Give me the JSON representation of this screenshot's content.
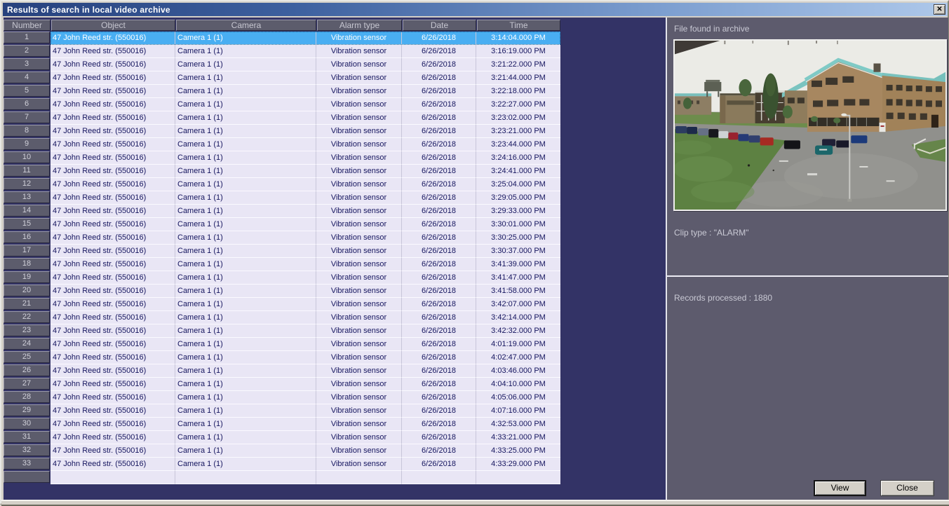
{
  "window": {
    "title": "Results of search in local video archive",
    "close_glyph": "✕"
  },
  "table": {
    "columns": [
      "Number",
      "Object",
      "Camera",
      "Alarm type",
      "Date",
      "Time"
    ],
    "object": "47 John Reed str. (550016)",
    "camera": "Camera 1 (1)",
    "alarm_type": "Vibration sensor",
    "date": "6/26/2018",
    "times": [
      "3:14:04.000 PM",
      "3:16:19.000 PM",
      "3:21:22.000 PM",
      "3:21:44.000 PM",
      "3:22:18.000 PM",
      "3:22:27.000 PM",
      "3:23:02.000 PM",
      "3:23:21.000 PM",
      "3:23:44.000 PM",
      "3:24:16.000 PM",
      "3:24:41.000 PM",
      "3:25:04.000 PM",
      "3:29:05.000 PM",
      "3:29:33.000 PM",
      "3:30:01.000 PM",
      "3:30:25.000 PM",
      "3:30:37.000 PM",
      "3:41:39.000 PM",
      "3:41:47.000 PM",
      "3:41:58.000 PM",
      "3:42:07.000 PM",
      "3:42:14.000 PM",
      "3:42:32.000 PM",
      "4:01:19.000 PM",
      "4:02:47.000 PM",
      "4:03:46.000 PM",
      "4:04:10.000 PM",
      "4:05:06.000 PM",
      "4:07:16.000 PM",
      "4:32:53.000 PM",
      "4:33:21.000 PM",
      "4:33:25.000 PM",
      "4:33:29.000 PM"
    ],
    "selected_row": 1
  },
  "preview": {
    "title": "File found in archive",
    "clip_type": "Clip type : \"ALARM\"",
    "records": "Records processed : 1880",
    "image_description": "campus-building-parking-lot"
  },
  "buttons": {
    "view": "View",
    "close": "Close"
  },
  "colors": {
    "selection_blue": "#49aef2",
    "title_gradient_left": "#27417d",
    "title_gradient_right": "#aec8ea",
    "left_panel_navy": "#333366",
    "right_panel_gray": "#5d5b6d",
    "row_bg": "#e9e6f5",
    "header_cell_gray": "#5c5c6c"
  }
}
